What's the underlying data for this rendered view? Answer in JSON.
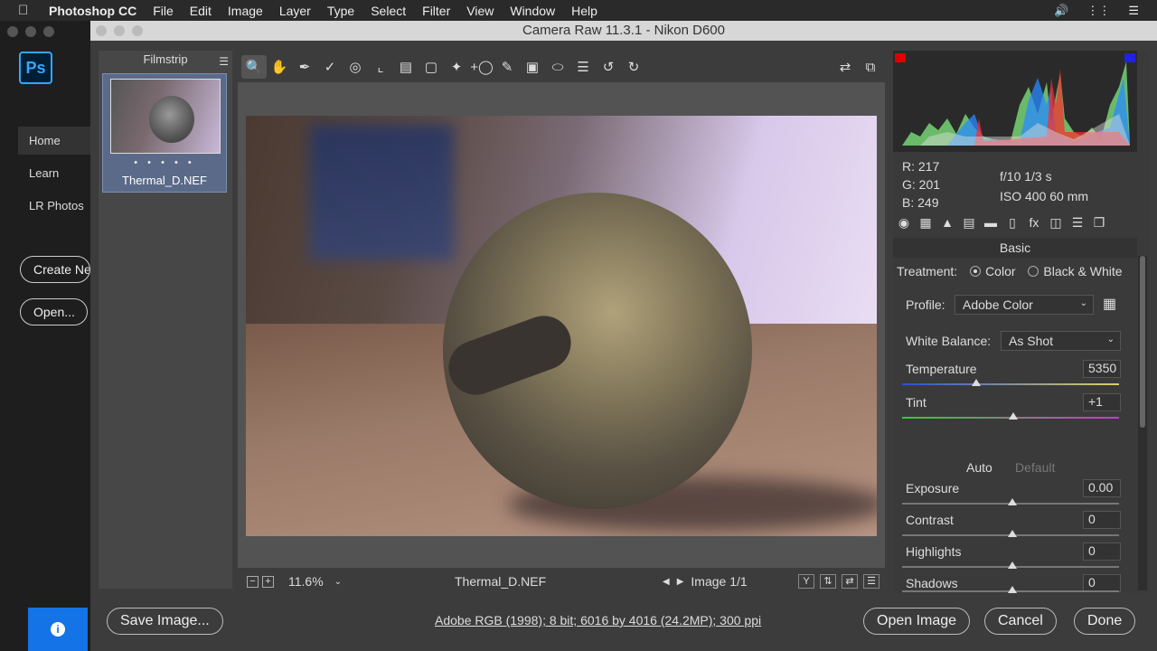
{
  "menubar": {
    "app": "Photoshop CC",
    "items": [
      "File",
      "Edit",
      "Image",
      "Layer",
      "Type",
      "Select",
      "Filter",
      "View",
      "Window",
      "Help"
    ]
  },
  "ps_home": {
    "logo": "Ps",
    "nav": [
      "Home",
      "Learn",
      "LR Photos"
    ],
    "create_btn": "Create Ne",
    "open_btn": "Open..."
  },
  "camera_raw": {
    "title": "Camera Raw 11.3.1  -  Nikon D600",
    "filmstrip": {
      "header": "Filmstrip",
      "rating": "• • • • •",
      "filename": "Thermal_D.NEF"
    },
    "status": {
      "zoom": "11.6%",
      "filename": "Thermal_D.NEF",
      "image_index": "Image 1/1",
      "y_label": "Y"
    },
    "readout": {
      "r": "R:   217",
      "g": "G:   201",
      "b": "B:   249",
      "aperture_shutter": "f/10    1/3 s",
      "iso_focal": "ISO 400    60 mm"
    },
    "basic": {
      "header": "Basic",
      "treatment_label": "Treatment:",
      "treatment_color": "Color",
      "treatment_bw": "Black & White",
      "profile_label": "Profile:",
      "profile_value": "Adobe Color",
      "wb_label": "White Balance:",
      "wb_value": "As Shot",
      "auto": "Auto",
      "default": "Default",
      "sliders": [
        {
          "label": "Temperature",
          "value": "5350",
          "pos": 0.33
        },
        {
          "label": "Tint",
          "value": "+1",
          "pos": 0.5
        },
        {
          "label": "Exposure",
          "value": "0.00",
          "pos": 0.5
        },
        {
          "label": "Contrast",
          "value": "0",
          "pos": 0.5
        },
        {
          "label": "Highlights",
          "value": "0",
          "pos": 0.5
        },
        {
          "label": "Shadows",
          "value": "0",
          "pos": 0.5
        }
      ]
    },
    "bottom": {
      "save": "Save Image...",
      "workflow": "Adobe RGB (1998); 8 bit; 6016 by 4016 (24.2MP); 300 ppi",
      "open": "Open Image",
      "cancel": "Cancel",
      "done": "Done"
    }
  }
}
